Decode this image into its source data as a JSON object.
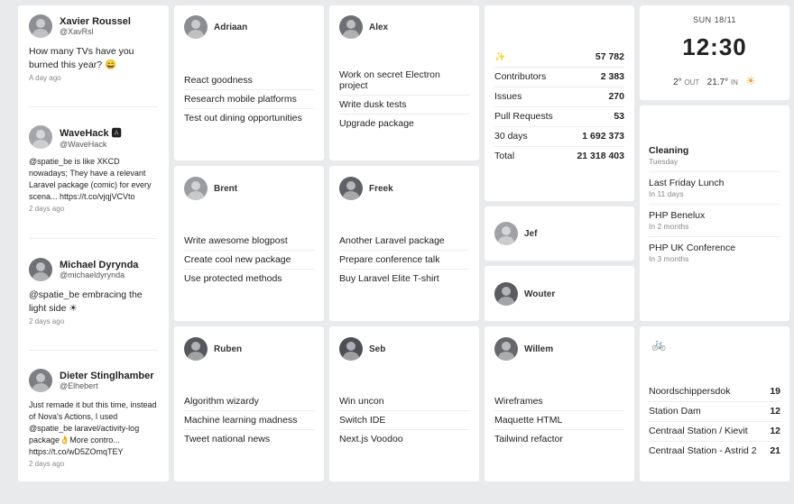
{
  "twitter": {
    "tweets": [
      {
        "name": "Xavier Roussel",
        "handle": "@XavRsl",
        "text": "How many TVs have you burned this year? 😄",
        "date": "A day ago",
        "avatar_color": "#8d8f94"
      },
      {
        "name": "WaveHack 🅰",
        "handle": "@WaveHack",
        "text": "@spatie_be is like XKCD nowadays; They have a relevant Laravel package (comic) for every scena... https://t.co/vjqjVCVto",
        "date": "2 days ago",
        "avatar_color": "#a4a6aa"
      },
      {
        "name": "Michael Dyrynda",
        "handle": "@michaeldyrynda",
        "text": "@spatie_be embracing the light side ☀",
        "date": "2 days ago",
        "avatar_color": "#6f7176"
      },
      {
        "name": "Dieter Stinglhamber",
        "handle": "@Elhebert",
        "text": "Just remade it but this time, instead of Nova's Actions, I used @spatie_be laravel/activity-log package👌More contro... https://t.co/wD5ZOmqTEY",
        "date": "2 days ago",
        "avatar_color": "#7c7e83"
      }
    ]
  },
  "people": [
    {
      "name": "Adriaan",
      "avatar_color": "#8a8c90",
      "tasks": [
        "React goodness",
        "Research mobile platforms",
        "Test out dining opportunities"
      ]
    },
    {
      "name": "Alex",
      "avatar_color": "#6e7075",
      "tasks": [
        "Work on secret Electron project",
        "Write dusk tests",
        "Upgrade package"
      ]
    },
    {
      "name": "Brent",
      "avatar_color": "#9a9ca0",
      "tasks": [
        "Write awesome blogpost",
        "Create cool new package",
        "Use protected methods"
      ]
    },
    {
      "name": "Freek",
      "avatar_color": "#5f6166",
      "tasks": [
        "Another Laravel package",
        "Prepare conference talk",
        "Buy Laravel Elite T-shirt"
      ]
    },
    {
      "name": "Ruben",
      "avatar_color": "#55575c",
      "tasks": [
        "Algorithm wizardy",
        "Machine learning madness",
        "Tweet national news"
      ]
    },
    {
      "name": "Seb",
      "avatar_color": "#4d4f54",
      "tasks": [
        "Win uncon",
        "Switch IDE",
        "Next.js Voodoo"
      ]
    },
    {
      "name": "Willem",
      "avatar_color": "#66686d",
      "tasks": [
        "Wireframes",
        "Maquette HTML",
        "Tailwind refactor"
      ]
    },
    {
      "name": "Jef",
      "avatar_color": "#a0a2a6",
      "tasks": []
    },
    {
      "name": "Wouter",
      "avatar_color": "#5a5c61",
      "tasks": []
    }
  ],
  "stats": {
    "star_icon": "✨",
    "stars": "57 782",
    "rows": [
      {
        "label": "Contributors",
        "value": "2 383"
      },
      {
        "label": "Issues",
        "value": "270"
      },
      {
        "label": "Pull Requests",
        "value": "53"
      },
      {
        "label": "30 days",
        "value": "1 692 373"
      },
      {
        "label": "Total",
        "value": "21 318 403"
      }
    ]
  },
  "clock": {
    "date": "SUN 18/11",
    "time": "12:30",
    "temp_out": "2°",
    "out_label": "OUT",
    "temp_in": "21.7°",
    "in_label": "IN",
    "weather_icon": "☀"
  },
  "calendar": {
    "events": [
      {
        "title": "Cleaning",
        "when": "Tuesday",
        "bold": true
      },
      {
        "title": "Last Friday Lunch",
        "when": "In 11 days",
        "bold": false
      },
      {
        "title": "PHP Benelux",
        "when": "In 2 months",
        "bold": false
      },
      {
        "title": "PHP UK Conference",
        "when": "In 3 months",
        "bold": false
      }
    ]
  },
  "velo": {
    "icon": "🚲",
    "stations": [
      {
        "name": "Noordschippersdok",
        "count": "19"
      },
      {
        "name": "Station Dam",
        "count": "12"
      },
      {
        "name": "Centraal Station / Kievit",
        "count": "12"
      },
      {
        "name": "Centraal Station - Astrid 2",
        "count": "21"
      }
    ]
  },
  "colors": {
    "accent": "#f0a030",
    "background": "#e9eaec",
    "tile": "#ffffff"
  }
}
